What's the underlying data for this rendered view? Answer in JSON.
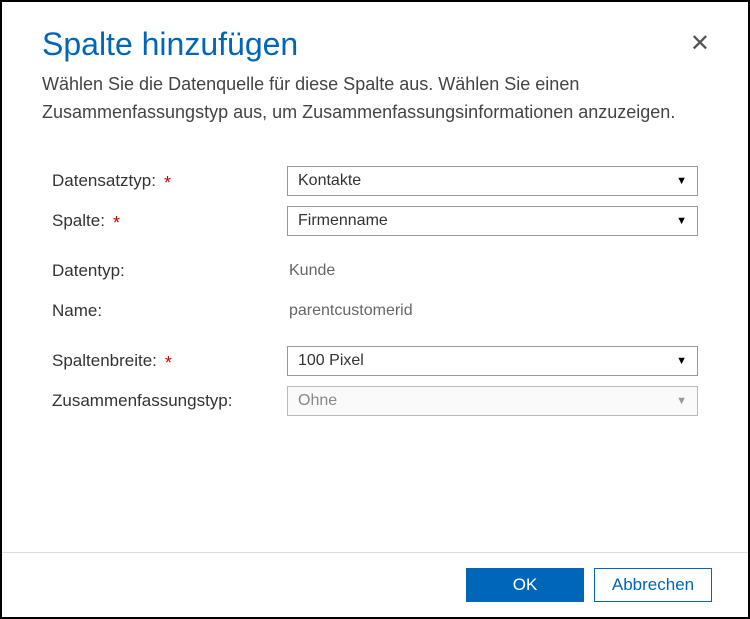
{
  "dialog": {
    "title": "Spalte hinzufügen",
    "description": "Wählen Sie die Datenquelle für diese Spalte aus. Wählen Sie einen Zusammenfassungstyp aus, um Zusammenfassungsinformationen anzuzeigen."
  },
  "fields": {
    "recordType": {
      "label": "Datensatztyp:",
      "value": "Kontakte"
    },
    "column": {
      "label": "Spalte:",
      "value": "Firmenname"
    },
    "dataType": {
      "label": "Datentyp:",
      "value": "Kunde"
    },
    "name": {
      "label": "Name:",
      "value": "parentcustomerid"
    },
    "columnWidth": {
      "label": "Spaltenbreite:",
      "value": "100 Pixel"
    },
    "summaryType": {
      "label": "Zusammenfassungstyp:",
      "value": "Ohne"
    }
  },
  "requiredMarker": "*",
  "buttons": {
    "ok": "OK",
    "cancel": "Abbrechen"
  }
}
